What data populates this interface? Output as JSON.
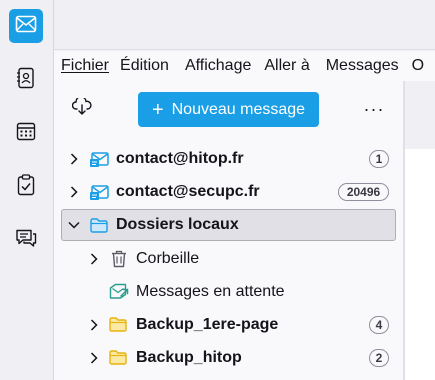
{
  "spaces": [
    {
      "name": "mail-icon",
      "active": true
    },
    {
      "name": "address-book-icon",
      "active": false
    },
    {
      "name": "calendar-icon",
      "active": false
    },
    {
      "name": "tasks-icon",
      "active": false
    },
    {
      "name": "chat-icon",
      "active": false
    }
  ],
  "menubar": {
    "items": [
      "Fichier",
      "Édition",
      "Affichage",
      "Aller à",
      "Messages",
      "O"
    ]
  },
  "folder_pane": {
    "write_label": "Nouveau message",
    "write_icon": "plus-icon",
    "more_label": "···",
    "get_messages_icon": "get-messages-icon"
  },
  "folders": [
    {
      "label": "contact@hitop.fr",
      "icon": "mail-account-icon",
      "badge": "1",
      "bold": true
    },
    {
      "label": "contact@secupc.fr",
      "icon": "mail-account-icon",
      "badge": "20496",
      "bold": true
    },
    {
      "label": "Dossiers locaux",
      "icon": "local-folders-icon",
      "badge": "",
      "bold": true,
      "selected": true
    },
    {
      "label": "Corbeille",
      "icon": "trash-icon",
      "badge": "",
      "bold": false
    },
    {
      "label": "Messages en attente",
      "icon": "outbox-icon",
      "badge": "",
      "bold": false
    },
    {
      "label": "Backup_1ere-page",
      "icon": "folder-icon",
      "badge": "4",
      "bold": true
    },
    {
      "label": "Backup_hitop",
      "icon": "folder-icon",
      "badge": "2",
      "bold": true
    }
  ],
  "colors": {
    "accent": "#1a9fe6",
    "folder_yellow": "#f3c33b"
  }
}
